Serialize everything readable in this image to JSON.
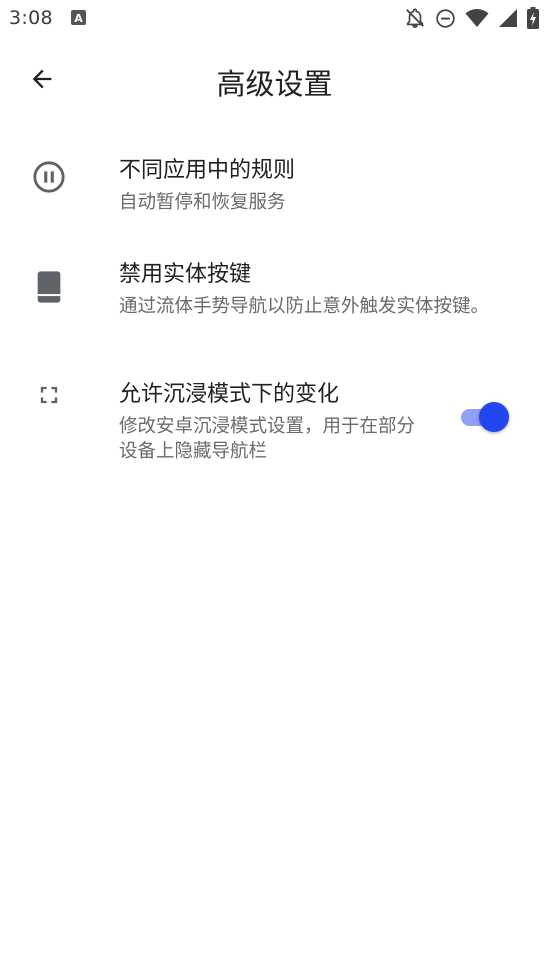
{
  "status_bar": {
    "time": "3:08",
    "notification_icon": "a-letter-icon",
    "icons": [
      "notifications-off-icon",
      "do-not-disturb-icon",
      "wifi-icon",
      "signal-icon",
      "battery-charging-icon"
    ]
  },
  "app_bar": {
    "back_icon": "arrow-back-icon",
    "title": "高级设置"
  },
  "settings": [
    {
      "icon": "pause-circle-icon",
      "title": "不同应用中的规则",
      "summary": "自动暂停和恢复服务"
    },
    {
      "icon": "tablet-icon",
      "title": "禁用实体按键",
      "summary": "通过流体手势导航以防止意外触发实体按键。"
    },
    {
      "icon": "fullscreen-icon",
      "title": "允许沉浸模式下的变化",
      "summary": "修改安卓沉浸模式设置，用于在部分设备上隐藏导航栏",
      "toggle_on": true
    }
  ],
  "colors": {
    "accent": "#2446f0",
    "accent_track": "#8fa0f5",
    "text_primary": "#202124",
    "text_secondary": "#6b6b6b",
    "icon": "#5f6368"
  }
}
